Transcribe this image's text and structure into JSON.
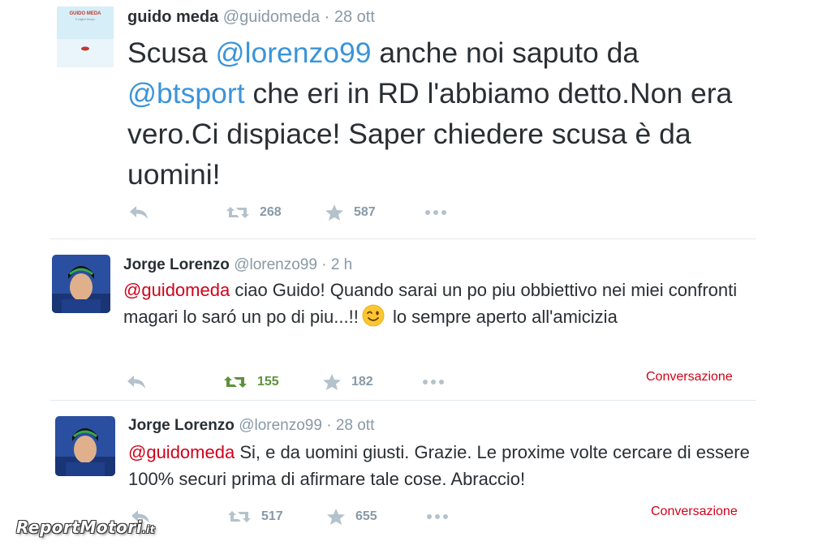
{
  "tweets": [
    {
      "name": "guido meda",
      "handle": "@guidomeda",
      "time": "· 28 ott",
      "text_parts": [
        {
          "kind": "mention",
          "text": "Scusa "
        },
        {
          "kind": "mention",
          "text": "@lorenzo99"
        },
        {
          "kind": "text",
          "text": " anche noi saputo da "
        },
        {
          "kind": "mention",
          "text": "@btsport"
        },
        {
          "kind": "text",
          "text": " che eri in RD l'abbiamo detto.Non era vero.Ci dispiace! Saper chiedere scusa è da uomini!"
        }
      ],
      "avatar_book": {
        "title": "GUIDO MEDA",
        "subtitle": "Il miglior tempo"
      },
      "retweets": "268",
      "favorites": "587"
    },
    {
      "name": "Jorge Lorenzo",
      "handle": "@lorenzo99",
      "time": "· 2 h",
      "mention": "@guidomeda",
      "text_a": " ciao Guido! Quando sarai un po piu obbiettivo nei miei confronti magari lo saró un po di piu...!!",
      "text_b": " lo sempre aperto all'amicizia",
      "emoji": "wink-emoji",
      "retweets": "155",
      "favorites": "182",
      "conversation": "Conversazione"
    },
    {
      "name": "Jorge Lorenzo",
      "handle": "@lorenzo99",
      "time": "· 28 ott",
      "mention": "@guidomeda",
      "text": " Si, e da uomini giusti. Grazie. Le proxime volte cercare di essere 100% securi prima di afirmare tale cose. Abraccio!",
      "retweets": "517",
      "favorites": "655",
      "conversation": "Conversazione"
    }
  ],
  "icons": {
    "reply": "reply-icon",
    "retweet": "retweet-icon",
    "favorite": "star-icon",
    "more": "more-icon"
  },
  "colors": {
    "mention_blue": "#3b94d9",
    "mention_red": "#d0021b",
    "retweeted_green": "#5c913b",
    "meta_gray": "#8899a6"
  },
  "watermark": {
    "main": "ReportMotori",
    "suffix": ".it"
  }
}
